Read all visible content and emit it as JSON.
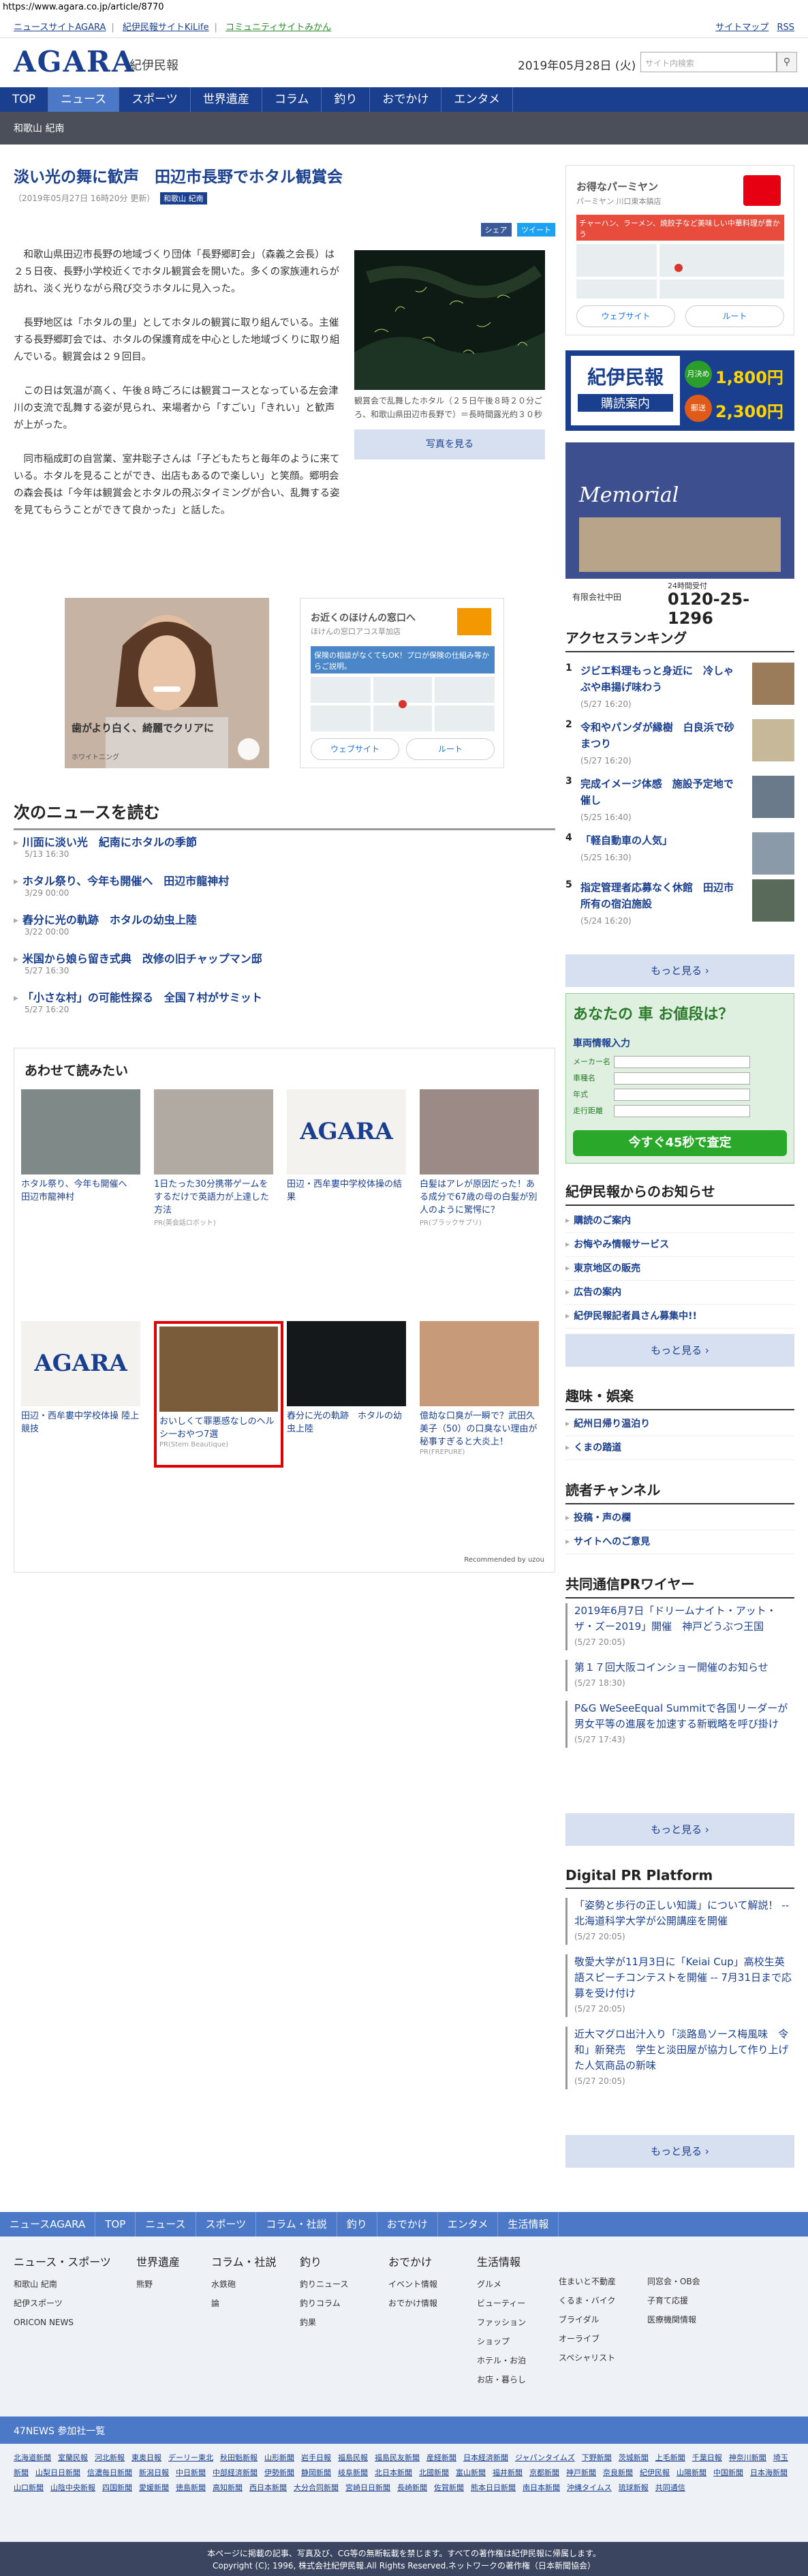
{
  "url": "https://www.agara.co.jp/article/8770",
  "topstrip": {
    "links": [
      "ニュースサイトAGARA",
      "紀伊民報サイトKiLife",
      "コミュニティサイトみかん"
    ],
    "right": [
      "サイトマップ",
      "RSS"
    ]
  },
  "header": {
    "logo": "AGARA",
    "logo_sub": "紀伊民報",
    "date": "2019年05月28日 (火)",
    "search_placeholder": "サイト内検索",
    "search_icon": "search-icon"
  },
  "nav": [
    "TOP",
    "ニュース",
    "スポーツ",
    "世界遺産",
    "コラム",
    "釣り",
    "おでかけ",
    "エンタメ"
  ],
  "subnav": "和歌山 紀南",
  "article": {
    "title": "淡い光の舞に歓声　田辺市長野でホタル観賞会",
    "meta": "（2019年05月27日 16時20分 更新）",
    "tag": "和歌山 紀南",
    "share": [
      "シェア",
      "ツイート"
    ],
    "paragraphs": [
      "和歌山県田辺市長野の地域づくり団体「長野郷町会」（森義之会長）は２５日夜、長野小学校近くでホタル観賞会を開いた。多くの家族連れらが訪れ、淡く光りながら飛び交うホタルに見入った。",
      "長野地区は「ホタルの里」としてホタルの観賞に取り組んでいる。主催する長野郷町会では、ホタルの保護育成を中心とした地域づくりに取り組んでいる。観賞会は２９回目。",
      "この日は気温が高く、午後８時ごろには観賞コースとなっている左会津川の支流で乱舞する姿が見られ、来場者から「すごい」「きれい」と歓声が上がった。",
      "同市稲成町の自営業、室井聡子さんは「子どもたちと毎年のように来ている。ホタルを見ることができ、出店もあるので楽しい」と笑顔。郷明会の森会長は「今年は観賞会とホタルの飛ぶタイミングが合い、乱舞する姿を見てもらうことができて良かった」と話した。"
    ],
    "photo_caption": "観賞会で乱舞したホタル（２５日午後８時２０分ごろ、和歌山県田辺市長野で）＝長時間露光約３０秒",
    "photo_button": "写真を見る"
  },
  "ads": {
    "ad1_text": "歯がより白く、綺麗でクリアに",
    "ad1_sub": "ホワイトニング",
    "ad2_title": "お近くのほけんの窓口へ",
    "ad2_sub": "ほけんの窓口アコス草加店",
    "ad2_banner": "保険の相談がなくてもOK！プロが保険の仕組み等からご説明。",
    "ad2_buttons": [
      "ウェブサイト",
      "ルート"
    ]
  },
  "next_news": {
    "heading": "次のニュースを読む",
    "items": [
      {
        "title": "川面に淡い光　紀南にホタルの季節",
        "date": "5/13 16:30"
      },
      {
        "title": "ホタル祭り、今年も開催へ　田辺市龍神村",
        "date": "3/29 00:00"
      },
      {
        "title": "舂分に光の軌跡　ホタルの幼虫上陸",
        "date": "3/22 00:00"
      },
      {
        "title": "米国から娘ら留き式典　改修の旧チャップマン邸",
        "date": "5/27 16:30"
      },
      {
        "title": "「小さな村」の可能性探る　全国７村がサミット",
        "date": "5/27 16:20"
      }
    ]
  },
  "related": {
    "heading": "あわせて読みたい",
    "items": [
      {
        "title": "ホタル祭り、今年も開催へ　田辺市龍神村",
        "source": ""
      },
      {
        "title": "1日たった30分携帯ゲームをするだけで英語力が上達した方法",
        "source": "PR(英会話ロボット)"
      },
      {
        "title": "田辺・西牟婁中学校体操の結果",
        "source": ""
      },
      {
        "title": "白髪はアレが原因だった！ある成分で67歳の母の白髪が別人のように驚愕に？",
        "source": "PR(ブラックサプリ)"
      },
      {
        "title": "田辺・西牟婁中学校体操 陸上競技",
        "source": ""
      },
      {
        "title": "おいしくて罪悪感なしのヘルシ一おやつ7選",
        "source": "PR(Stem Beautique)"
      },
      {
        "title": "舂分に光の軌跡　ホタルの幼虫上陸",
        "source": ""
      },
      {
        "title": "億劫な口臭が一瞬で？武田久美子（50）の口臭ない理由が秘事すぎると大炎上！",
        "source": "PR(FREPURE)"
      }
    ],
    "recommended": "Recommended by uzou"
  },
  "side": {
    "ad_pin": {
      "title": "お得なパーミヤン",
      "sub": "パーミヤン 川口東本鎮店",
      "banner": "チャーハン、ラーメン、焼餃子など美味しい中華料理が豊かう",
      "buttons": [
        "ウェブサイト",
        "ルート"
      ]
    },
    "kii_ad": {
      "name": "紀伊民報",
      "label": "購読案内",
      "month": "月決め",
      "month_price": "1,800円",
      "post": "郵送",
      "post_price": "2,300円"
    },
    "memorial": {
      "title": "Memorial",
      "tel": "0120-25-1296",
      "company": "有限会社中田",
      "hours": "24時間受付"
    },
    "ranking": {
      "heading": "アクセスランキング",
      "items": [
        {
          "rank": "1",
          "title": "ジビエ料理もっと身近に　冷しゃぶや串揚げ味わう",
          "date": "(5/27 16:20)"
        },
        {
          "rank": "2",
          "title": "令和やパンダが縁樹　白良浜で砂まつり",
          "date": "(5/27 16:20)"
        },
        {
          "rank": "3",
          "title": "完成イメージ体感　施設予定地で催し",
          "date": "(5/25 16:40)"
        },
        {
          "rank": "4",
          "title": "「軽自動車の人気」",
          "date": "(5/25 16:30)"
        },
        {
          "rank": "5",
          "title": "指定管理者応募なく休館　田辺市所有の宿泊施設",
          "date": "(5/24 16:20)"
        }
      ],
      "more": "もっと見る ›"
    },
    "car_ad": {
      "title": "あなたの 車 お値段は？",
      "form_title": "車両情報入力",
      "labels": [
        "メーカー名",
        "車種名",
        "年式",
        "走行距離"
      ],
      "cta": "今すぐ45秒で査定"
    },
    "notice": {
      "heading": "紀伊民報からのお知らせ",
      "items": [
        "購読のご案内",
        "お悔やみ情報サービス",
        "東京地区の販売",
        "広告の案内",
        "紀伊民報記者員さん募集中!!"
      ],
      "more": "もっと見る ›"
    },
    "hobby": {
      "heading": "趣味・娯楽",
      "items": [
        "紀州日帰り温泊り",
        "くまの踏道"
      ]
    },
    "reader": {
      "heading": "読者チャンネル",
      "items": [
        "投稿・声の欄",
        "サイトへのご意見"
      ]
    },
    "pr_wire": {
      "heading": "共同通信PRワイヤー",
      "items": [
        {
          "title": "2019年6月7日「ドリームナイト・アット・ザ・ズー2019」開催　神戸どうぶつ王国",
          "date": "(5/27 20:05)"
        },
        {
          "title": "第１７回大阪コインショー開催のお知らせ",
          "date": "(5/27 18:30)"
        },
        {
          "title": "P&G WeSeeEqual Summitで各国リーダーが男女平等の進展を加速する新戦略を呼び掛け",
          "date": "(5/27 17:43)"
        }
      ],
      "more": "もっと見る ›"
    },
    "digital_pr": {
      "heading": "Digital PR Platform",
      "items": [
        {
          "title": "「姿勢と歩行の正しい知識」について解説！ -- 北海道科学大学が公開講座を開催",
          "date": "(5/27 20:05)"
        },
        {
          "title": "敬愛大学が11月3日に「Keiai Cup」高校生英語スピーチコンテストを開催 -- 7月31日まで応募を受け付け",
          "date": "(5/27 20:05)"
        },
        {
          "title": "近大マグロ出汁入り「淡路島ソース梅風味　令和」新発売　学生と淡田屋が協力して作り上げた人気商品の新味",
          "date": "(5/27 20:05)"
        }
      ],
      "more": "もっと見る ›"
    }
  },
  "footer": {
    "nav": [
      "ニュースAGARA",
      "TOP",
      "ニュース",
      "スポーツ",
      "コラム・社説",
      "釣り",
      "おでかけ",
      "エンタメ",
      "生活情報"
    ],
    "cols": [
      {
        "head": "ニュース・スポーツ",
        "items": [
          "和歌山 紀南",
          "紀伊スポーツ",
          "ORICON NEWS"
        ]
      },
      {
        "head": "世界遺産",
        "items": [
          "熊野"
        ]
      },
      {
        "head": "コラム・社説",
        "items": [
          "水鉄砲",
          "論"
        ]
      },
      {
        "head": "釣り",
        "items": [
          "釣りニュース",
          "釣りコラム",
          "釣果"
        ]
      },
      {
        "head": "おでかけ",
        "items": [
          "イベント情報",
          "おでかけ情報"
        ]
      },
      {
        "head": "生活情報",
        "items": [
          "グルメ",
          "ビューティー",
          "ファッション",
          "ショップ",
          "ホテル・お泊",
          "お店・暮らし"
        ]
      },
      {
        "head": "",
        "items": [
          "住まいと不動産",
          "くるま・バイク",
          "ブライダル",
          "オーライブ",
          "スペシャリスト"
        ]
      },
      {
        "head": "",
        "items": [
          "同窓会・OB会",
          "子育て応援",
          "医療機関情報"
        ]
      }
    ],
    "news47": "47NEWS 参加社一覧",
    "papers": [
      "北海道新聞",
      "室蘭民報",
      "河北新報",
      "東奥日報",
      "デーリー東北",
      "秋田魁新報",
      "山形新聞",
      "岩手日報",
      "福島民報",
      "福島民友新聞",
      "産経新聞",
      "日本経済新聞",
      "ジャパンタイムズ",
      "下野新聞",
      "茨城新聞",
      "上毛新聞",
      "千葉日報",
      "神奈川新聞",
      "埼玉新聞",
      "山梨日日新聞",
      "信濃毎日新聞",
      "新潟日報",
      "中日新聞",
      "中部経済新聞",
      "伊勢新聞",
      "静岡新聞",
      "岐阜新聞",
      "北日本新聞",
      "北國新聞",
      "富山新聞",
      "福井新聞",
      "京都新聞",
      "神戸新聞",
      "奈良新聞",
      "紀伊民報",
      "山陽新聞",
      "中国新聞",
      "日本海新聞",
      "山口新聞",
      "山陰中央新報",
      "四国新聞",
      "愛媛新聞",
      "徳島新聞",
      "高知新聞",
      "西日本新聞",
      "大分合同新聞",
      "宮崎日日新聞",
      "長崎新聞",
      "佐賀新聞",
      "熊本日日新聞",
      "南日本新聞",
      "沖縄タイムス",
      "琉球新報",
      "共同通信"
    ],
    "copy1": "本ページに掲載の記事、写真及び、CG等の無断転載を禁じます。すべての著作権は紀伊民報に帰属します。",
    "copy2": "Copyright (C); 1996, 株式会社紀伊民報.All Rights Reserved.ネットワークの著作権（日本新聞協会）"
  }
}
